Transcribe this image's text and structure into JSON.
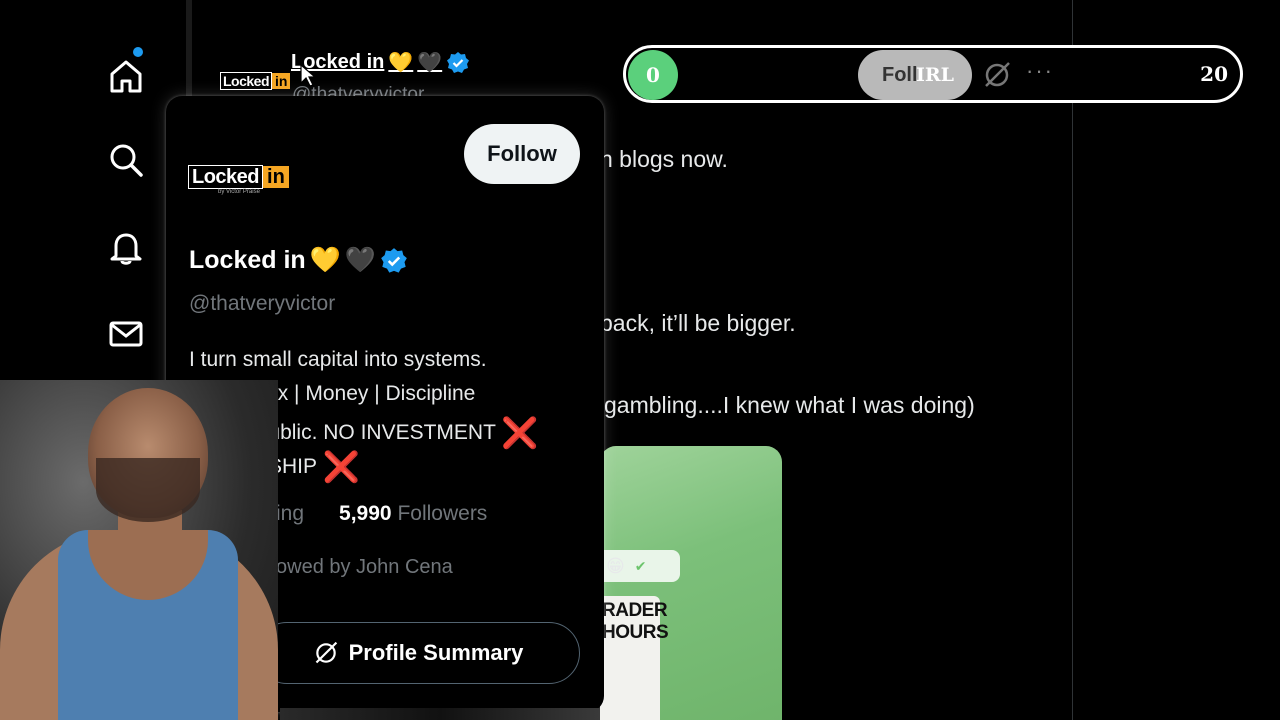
{
  "scoreboard": {
    "left_score": "0",
    "center_ghost": "Foll",
    "center_label": "IRL",
    "right_score": "20",
    "more_label": "···"
  },
  "tweet": {
    "author_name": "Locked in",
    "handle_partial": "@thatveryvictor",
    "avatar_text": "Locked",
    "avatar_badge": "in",
    "lines": [
      "n blogs now.",
      "back, it’ll be bigger.",
      "gambling....I knew what I was doing)"
    ],
    "image": {
      "emoji_1": "😁",
      "emoji_2": "✔",
      "card_line_1": "RADER",
      "card_line_2": "HOURS"
    }
  },
  "hover_card": {
    "avatar_text": "Locked",
    "avatar_badge": "in",
    "avatar_sub": "by Victor Praise",
    "follow_label": "Follow",
    "name": "Locked in",
    "emoji_yellow_heart": "💛",
    "emoji_black_heart": "🖤",
    "handle": "@thatveryvictor",
    "bio": [
      "I turn small capital into systems.",
      "ding Forex | Money | Discipline",
      "ding in public. NO INVESTMENT",
      "IENTORSHIP"
    ],
    "red_x": "❌",
    "following_partial": "ing",
    "followers_count": "5,990",
    "followers_label": "Followers",
    "followed_by": "owed by John Cena",
    "profile_summary_label": "Profile Summary"
  },
  "colors": {
    "verified": "#1d9bf0",
    "score_green": "#5bd07c",
    "red_x": "#e0245e"
  },
  "nav": {
    "items": [
      "home-icon",
      "search-icon",
      "bell-icon",
      "mail-icon"
    ]
  }
}
